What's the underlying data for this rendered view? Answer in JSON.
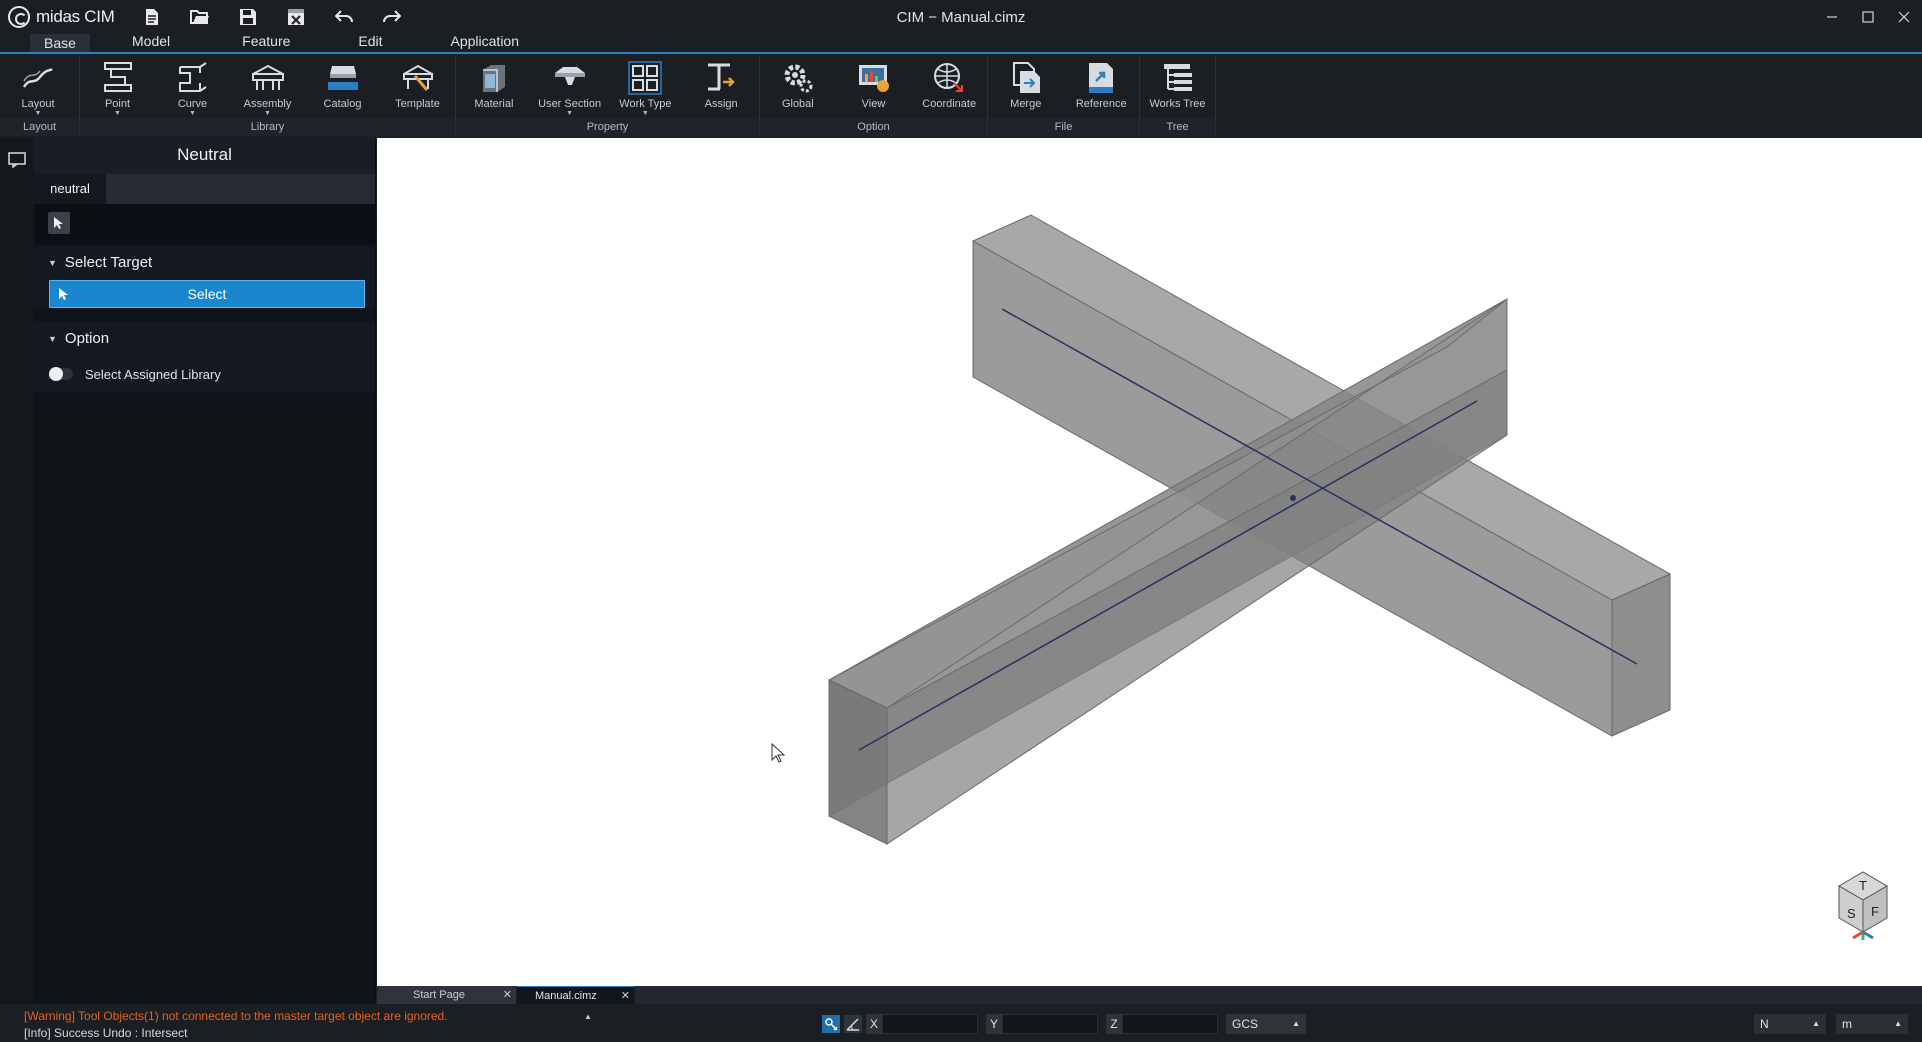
{
  "app": {
    "brand": "midas CIM",
    "title": "CIM − Manual.cimz"
  },
  "menu": {
    "tabs": [
      "Base",
      "Model",
      "Feature",
      "Edit",
      "Application"
    ],
    "active": "Base"
  },
  "ribbon": {
    "groups": [
      {
        "label": "Layout",
        "items": [
          {
            "label": "Layout",
            "icon": "layout-icon",
            "caret": true
          }
        ]
      },
      {
        "label": "Library",
        "items": [
          {
            "label": "Point",
            "icon": "point-icon",
            "caret": true
          },
          {
            "label": "Curve",
            "icon": "curve-icon",
            "caret": true
          },
          {
            "label": "Assembly",
            "icon": "assembly-icon",
            "caret": true
          },
          {
            "label": "Catalog",
            "icon": "catalog-icon",
            "caret": false
          },
          {
            "label": "Template",
            "icon": "template-icon",
            "caret": false
          }
        ]
      },
      {
        "label": "Property",
        "items": [
          {
            "label": "Material",
            "icon": "material-icon",
            "caret": false
          },
          {
            "label": "User Section",
            "icon": "user-section-icon",
            "caret": true
          },
          {
            "label": "Work Type",
            "icon": "work-type-icon",
            "caret": true
          },
          {
            "label": "Assign",
            "icon": "assign-icon",
            "caret": false
          }
        ]
      },
      {
        "label": "Option",
        "items": [
          {
            "label": "Global",
            "icon": "global-icon",
            "caret": false
          },
          {
            "label": "View",
            "icon": "view-icon",
            "caret": false
          },
          {
            "label": "Coordinate",
            "icon": "coordinate-icon",
            "caret": false
          }
        ]
      },
      {
        "label": "File",
        "items": [
          {
            "label": "Merge",
            "icon": "merge-icon",
            "caret": false
          },
          {
            "label": "Reference",
            "icon": "reference-icon",
            "caret": false
          }
        ]
      },
      {
        "label": "Tree",
        "items": [
          {
            "label": "Works Tree",
            "icon": "works-tree-icon",
            "caret": false
          }
        ]
      }
    ]
  },
  "panel": {
    "title": "Neutral",
    "tab": "neutral",
    "select_target": {
      "heading": "Select Target",
      "button": "Select"
    },
    "option": {
      "heading": "Option",
      "toggle_label": "Select Assigned Library",
      "toggle_on": false
    }
  },
  "doc_tabs": [
    {
      "label": "Start Page",
      "active": false
    },
    {
      "label": "Manual.cimz",
      "active": true
    }
  ],
  "status": {
    "warning": "[Warning] Tool Objects(1) not connected to the master target object are ignored.",
    "info": "[Info] Success Undo : Intersect",
    "coord_labels": [
      "X",
      "Y",
      "Z"
    ],
    "coord_values": [
      "",
      "",
      ""
    ],
    "system": "GCS",
    "force_unit": "N",
    "length_unit": "m"
  },
  "colors": {
    "accent": "#2a7fc1",
    "select_button": "#1a86d0",
    "warning": "#e6621f",
    "beam": "#7d7d7d",
    "axis_line": "#2a2f60"
  }
}
